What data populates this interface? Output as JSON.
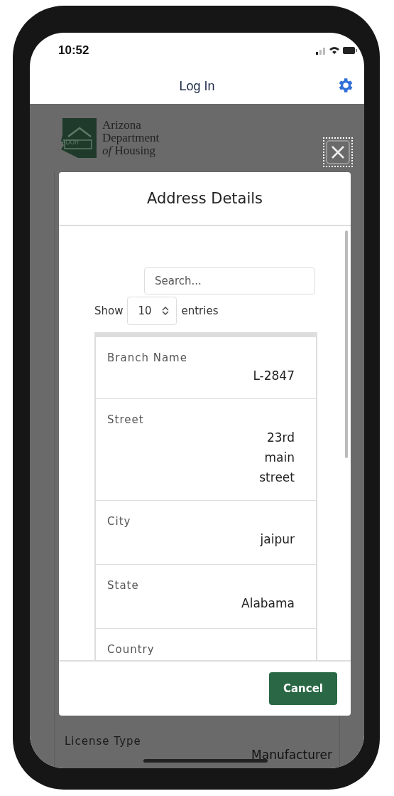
{
  "status_bar": {
    "time": "10:52"
  },
  "header": {
    "title": "Log In"
  },
  "logo": {
    "badge": "ADOH",
    "lines": [
      "Arizona",
      "Department",
      "*of* Housing"
    ]
  },
  "background_rows": [
    {
      "label": "License Type",
      "value": "Manufacturer"
    }
  ],
  "modal": {
    "title": "Address Details",
    "search": {
      "placeholder": "Search..."
    },
    "show_label": "Show",
    "page_size": "10",
    "entries_label": "entries",
    "rows": [
      {
        "label": "Branch Name",
        "value": "L-2847"
      },
      {
        "label": "Street",
        "value": "23rd main street"
      },
      {
        "label": "City",
        "value": "jaipur"
      },
      {
        "label": "State",
        "value": "Alabama"
      },
      {
        "label": "Country"
      }
    ],
    "cancel": "Cancel"
  }
}
